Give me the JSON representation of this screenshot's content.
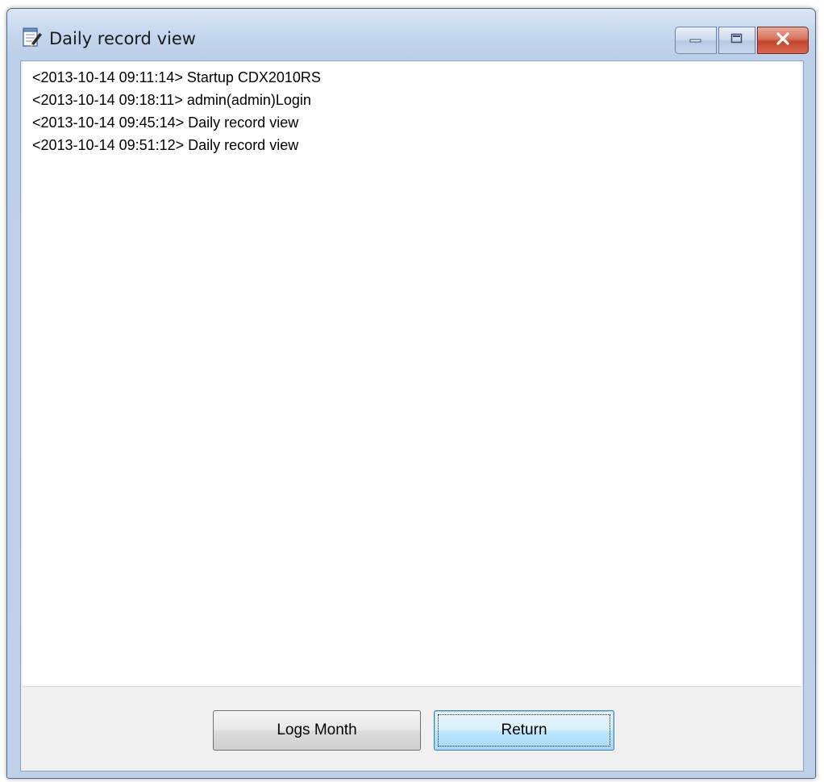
{
  "window": {
    "title": "Daily record view",
    "title_icon": "notepad-pencil-icon"
  },
  "caption_buttons": {
    "minimize_icon": "minimize-icon",
    "maximize_icon": "maximize-icon",
    "close_icon": "close-icon"
  },
  "log": {
    "lines": [
      "<2013-10-14 09:11:14> Startup CDX2010RS",
      "<2013-10-14 09:18:11> admin(admin)Login",
      "<2013-10-14 09:45:14> Daily record view",
      "<2013-10-14 09:51:12> Daily record view"
    ]
  },
  "buttons": {
    "logs_month": "Logs Month",
    "return": "Return"
  },
  "colors": {
    "titlebar": "#c5d7ee",
    "close_button": "#c2452c",
    "focus_button": "#bee6fd"
  }
}
